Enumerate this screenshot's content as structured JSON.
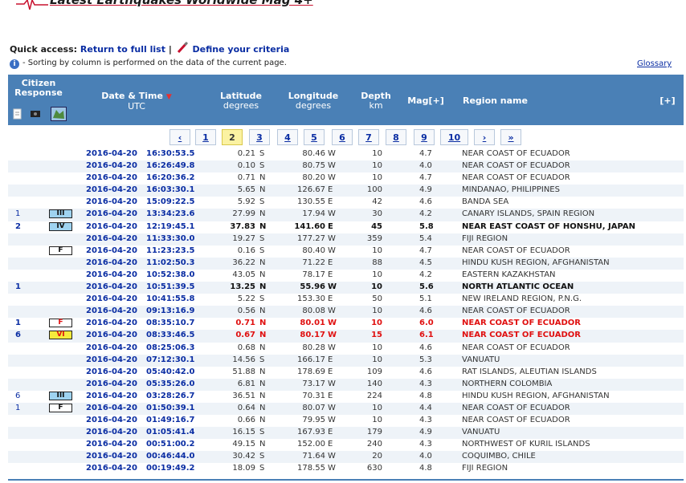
{
  "header": {
    "title": "Latest Earthquakes Worldwide Mag 4+",
    "quick_access_label": "Quick access:",
    "return_link": "Return to full list",
    "separator": "|",
    "criteria_link": "Define your criteria",
    "sort_note": "- Sorting by column is performed on the data of the current page.",
    "glossary": "Glossary"
  },
  "columns": {
    "citizen": "Citizen",
    "response": "Response",
    "datetime": "Date & Time",
    "datetime_sub": "UTC",
    "latitude": "Latitude",
    "latitude_sub": "degrees",
    "longitude": "Longitude",
    "longitude_sub": "degrees",
    "depth": "Depth",
    "depth_sub": "km",
    "mag": "Mag[+]",
    "region": "Region name",
    "expand": "[+]"
  },
  "pagination": [
    "‹",
    "1",
    "2",
    "3",
    "4",
    "5",
    "6",
    "7",
    "8",
    "9",
    "10",
    "›",
    "»"
  ],
  "current_page": "2",
  "colors": {
    "header_bg": "#4a80b6",
    "highlight_red": "#e01010",
    "link_blue": "#0a2da3",
    "alt_row": "#eef3f8"
  },
  "rows": [
    {
      "cit": "",
      "int": "",
      "date": "2016-04-20",
      "time": "16:30:53.5",
      "lat": "0.21",
      "ns": "S",
      "lon": "80.46",
      "ew": "W",
      "depth": "10",
      "mag": "4.7",
      "region": "NEAR COAST OF ECUADOR",
      "style": ""
    },
    {
      "cit": "",
      "int": "",
      "date": "2016-04-20",
      "time": "16:26:49.8",
      "lat": "0.10",
      "ns": "S",
      "lon": "80.75",
      "ew": "W",
      "depth": "10",
      "mag": "4.0",
      "region": "NEAR COAST OF ECUADOR",
      "style": ""
    },
    {
      "cit": "",
      "int": "",
      "date": "2016-04-20",
      "time": "16:20:36.2",
      "lat": "0.71",
      "ns": "N",
      "lon": "80.20",
      "ew": "W",
      "depth": "10",
      "mag": "4.7",
      "region": "NEAR COAST OF ECUADOR",
      "style": ""
    },
    {
      "cit": "",
      "int": "",
      "date": "2016-04-20",
      "time": "16:03:30.1",
      "lat": "5.65",
      "ns": "N",
      "lon": "126.67",
      "ew": "E",
      "depth": "100",
      "mag": "4.9",
      "region": "MINDANAO, PHILIPPINES",
      "style": ""
    },
    {
      "cit": "",
      "int": "",
      "date": "2016-04-20",
      "time": "15:09:22.5",
      "lat": "5.92",
      "ns": "S",
      "lon": "130.55",
      "ew": "E",
      "depth": "42",
      "mag": "4.6",
      "region": "BANDA SEA",
      "style": ""
    },
    {
      "cit": "1",
      "int": "III",
      "date": "2016-04-20",
      "time": "13:34:23.6",
      "lat": "27.99",
      "ns": "N",
      "lon": "17.94",
      "ew": "W",
      "depth": "30",
      "mag": "4.2",
      "region": "CANARY ISLANDS, SPAIN REGION",
      "style": ""
    },
    {
      "cit": "2",
      "int": "IV",
      "date": "2016-04-20",
      "time": "12:19:45.1",
      "lat": "37.83",
      "ns": "N",
      "lon": "141.60",
      "ew": "E",
      "depth": "45",
      "mag": "5.8",
      "region": "NEAR EAST COAST OF HONSHU, JAPAN",
      "style": "bold"
    },
    {
      "cit": "",
      "int": "",
      "date": "2016-04-20",
      "time": "11:33:30.0",
      "lat": "19.27",
      "ns": "S",
      "lon": "177.27",
      "ew": "W",
      "depth": "359",
      "mag": "5.4",
      "region": "FIJI REGION",
      "style": ""
    },
    {
      "cit": "",
      "int": "F",
      "date": "2016-04-20",
      "time": "11:23:23.5",
      "lat": "0.16",
      "ns": "S",
      "lon": "80.40",
      "ew": "W",
      "depth": "10",
      "mag": "4.7",
      "region": "NEAR COAST OF ECUADOR",
      "style": ""
    },
    {
      "cit": "",
      "int": "",
      "date": "2016-04-20",
      "time": "11:02:50.3",
      "lat": "36.22",
      "ns": "N",
      "lon": "71.22",
      "ew": "E",
      "depth": "88",
      "mag": "4.5",
      "region": "HINDU KUSH REGION, AFGHANISTAN",
      "style": ""
    },
    {
      "cit": "",
      "int": "",
      "date": "2016-04-20",
      "time": "10:52:38.0",
      "lat": "43.05",
      "ns": "N",
      "lon": "78.17",
      "ew": "E",
      "depth": "10",
      "mag": "4.2",
      "region": "EASTERN KAZAKHSTAN",
      "style": ""
    },
    {
      "cit": "1",
      "int": "",
      "date": "2016-04-20",
      "time": "10:51:39.5",
      "lat": "13.25",
      "ns": "N",
      "lon": "55.96",
      "ew": "W",
      "depth": "10",
      "mag": "5.6",
      "region": "NORTH ATLANTIC OCEAN",
      "style": "bold"
    },
    {
      "cit": "",
      "int": "",
      "date": "2016-04-20",
      "time": "10:41:55.8",
      "lat": "5.22",
      "ns": "S",
      "lon": "153.30",
      "ew": "E",
      "depth": "50",
      "mag": "5.1",
      "region": "NEW IRELAND REGION, P.N.G.",
      "style": ""
    },
    {
      "cit": "",
      "int": "",
      "date": "2016-04-20",
      "time": "09:13:16.9",
      "lat": "0.56",
      "ns": "N",
      "lon": "80.08",
      "ew": "W",
      "depth": "10",
      "mag": "4.6",
      "region": "NEAR COAST OF ECUADOR",
      "style": ""
    },
    {
      "cit": "1",
      "int": "F",
      "date": "2016-04-20",
      "time": "08:35:10.7",
      "lat": "0.71",
      "ns": "N",
      "lon": "80.01",
      "ew": "W",
      "depth": "10",
      "mag": "6.0",
      "region": "NEAR COAST OF ECUADOR",
      "style": "red"
    },
    {
      "cit": "6",
      "int": "VI",
      "date": "2016-04-20",
      "time": "08:33:46.5",
      "lat": "0.67",
      "ns": "N",
      "lon": "80.17",
      "ew": "W",
      "depth": "15",
      "mag": "6.1",
      "region": "NEAR COAST OF ECUADOR",
      "style": "red"
    },
    {
      "cit": "",
      "int": "",
      "date": "2016-04-20",
      "time": "08:25:06.3",
      "lat": "0.68",
      "ns": "N",
      "lon": "80.28",
      "ew": "W",
      "depth": "10",
      "mag": "4.6",
      "region": "NEAR COAST OF ECUADOR",
      "style": ""
    },
    {
      "cit": "",
      "int": "",
      "date": "2016-04-20",
      "time": "07:12:30.1",
      "lat": "14.56",
      "ns": "S",
      "lon": "166.17",
      "ew": "E",
      "depth": "10",
      "mag": "5.3",
      "region": "VANUATU",
      "style": ""
    },
    {
      "cit": "",
      "int": "",
      "date": "2016-04-20",
      "time": "05:40:42.0",
      "lat": "51.88",
      "ns": "N",
      "lon": "178.69",
      "ew": "E",
      "depth": "109",
      "mag": "4.6",
      "region": "RAT ISLANDS, ALEUTIAN ISLANDS",
      "style": ""
    },
    {
      "cit": "",
      "int": "",
      "date": "2016-04-20",
      "time": "05:35:26.0",
      "lat": "6.81",
      "ns": "N",
      "lon": "73.17",
      "ew": "W",
      "depth": "140",
      "mag": "4.3",
      "region": "NORTHERN COLOMBIA",
      "style": ""
    },
    {
      "cit": "6",
      "int": "III",
      "date": "2016-04-20",
      "time": "03:28:26.7",
      "lat": "36.51",
      "ns": "N",
      "lon": "70.31",
      "ew": "E",
      "depth": "224",
      "mag": "4.8",
      "region": "HINDU KUSH REGION, AFGHANISTAN",
      "style": ""
    },
    {
      "cit": "1",
      "int": "F",
      "date": "2016-04-20",
      "time": "01:50:39.1",
      "lat": "0.64",
      "ns": "N",
      "lon": "80.07",
      "ew": "W",
      "depth": "10",
      "mag": "4.4",
      "region": "NEAR COAST OF ECUADOR",
      "style": ""
    },
    {
      "cit": "",
      "int": "",
      "date": "2016-04-20",
      "time": "01:49:16.7",
      "lat": "0.66",
      "ns": "N",
      "lon": "79.95",
      "ew": "W",
      "depth": "10",
      "mag": "4.3",
      "region": "NEAR COAST OF ECUADOR",
      "style": ""
    },
    {
      "cit": "",
      "int": "",
      "date": "2016-04-20",
      "time": "01:05:41.4",
      "lat": "16.15",
      "ns": "S",
      "lon": "167.93",
      "ew": "E",
      "depth": "179",
      "mag": "4.9",
      "region": "VANUATU",
      "style": ""
    },
    {
      "cit": "",
      "int": "",
      "date": "2016-04-20",
      "time": "00:51:00.2",
      "lat": "49.15",
      "ns": "N",
      "lon": "152.00",
      "ew": "E",
      "depth": "240",
      "mag": "4.3",
      "region": "NORTHWEST OF KURIL ISLANDS",
      "style": ""
    },
    {
      "cit": "",
      "int": "",
      "date": "2016-04-20",
      "time": "00:46:44.0",
      "lat": "30.42",
      "ns": "S",
      "lon": "71.64",
      "ew": "W",
      "depth": "20",
      "mag": "4.0",
      "region": "COQUIMBO, CHILE",
      "style": ""
    },
    {
      "cit": "",
      "int": "",
      "date": "2016-04-20",
      "time": "00:19:49.2",
      "lat": "18.09",
      "ns": "S",
      "lon": "178.55",
      "ew": "W",
      "depth": "630",
      "mag": "4.8",
      "region": "FIJI REGION",
      "style": ""
    }
  ]
}
